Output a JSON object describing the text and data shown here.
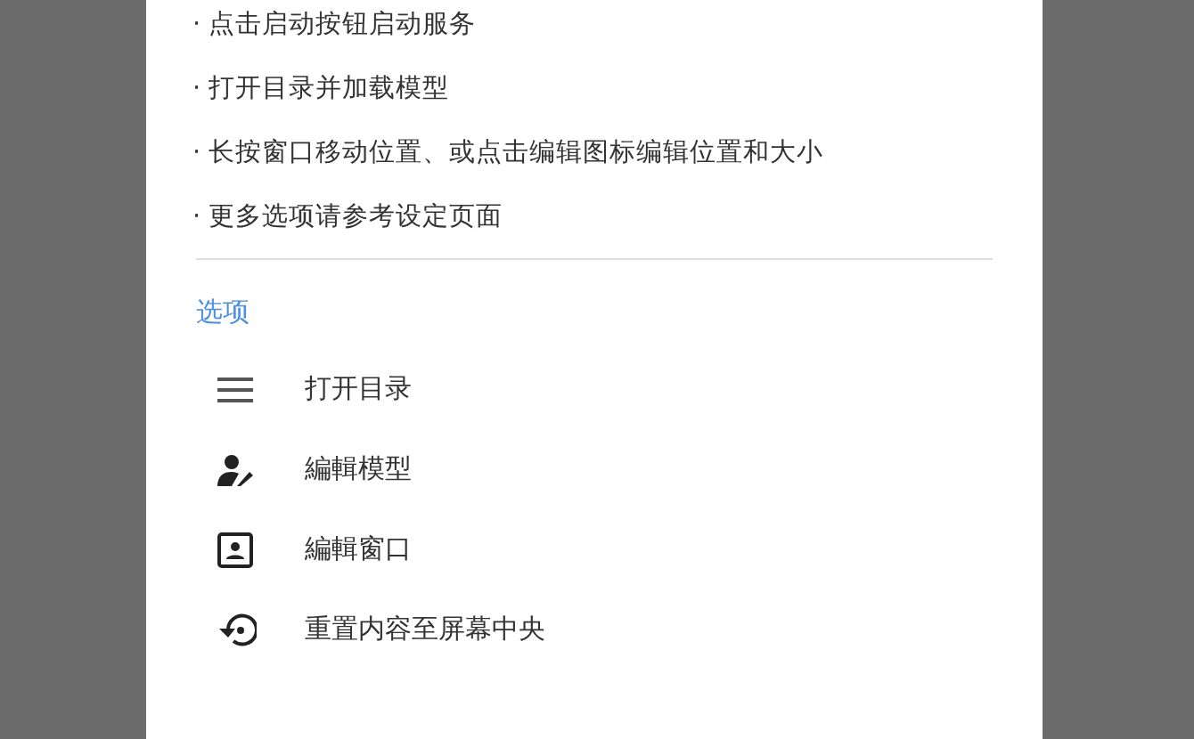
{
  "tips": [
    "· 点击启动按钮启动服务",
    "· 打开目录并加载模型",
    "· 长按窗口移动位置、或点击编辑图标编辑位置和大小",
    "· 更多选项请参考设定页面"
  ],
  "options": {
    "title": "选项",
    "items": [
      {
        "label": "打开目录"
      },
      {
        "label": "編輯模型"
      },
      {
        "label": "編輯窗口"
      },
      {
        "label": "重置内容至屏幕中央"
      }
    ]
  }
}
